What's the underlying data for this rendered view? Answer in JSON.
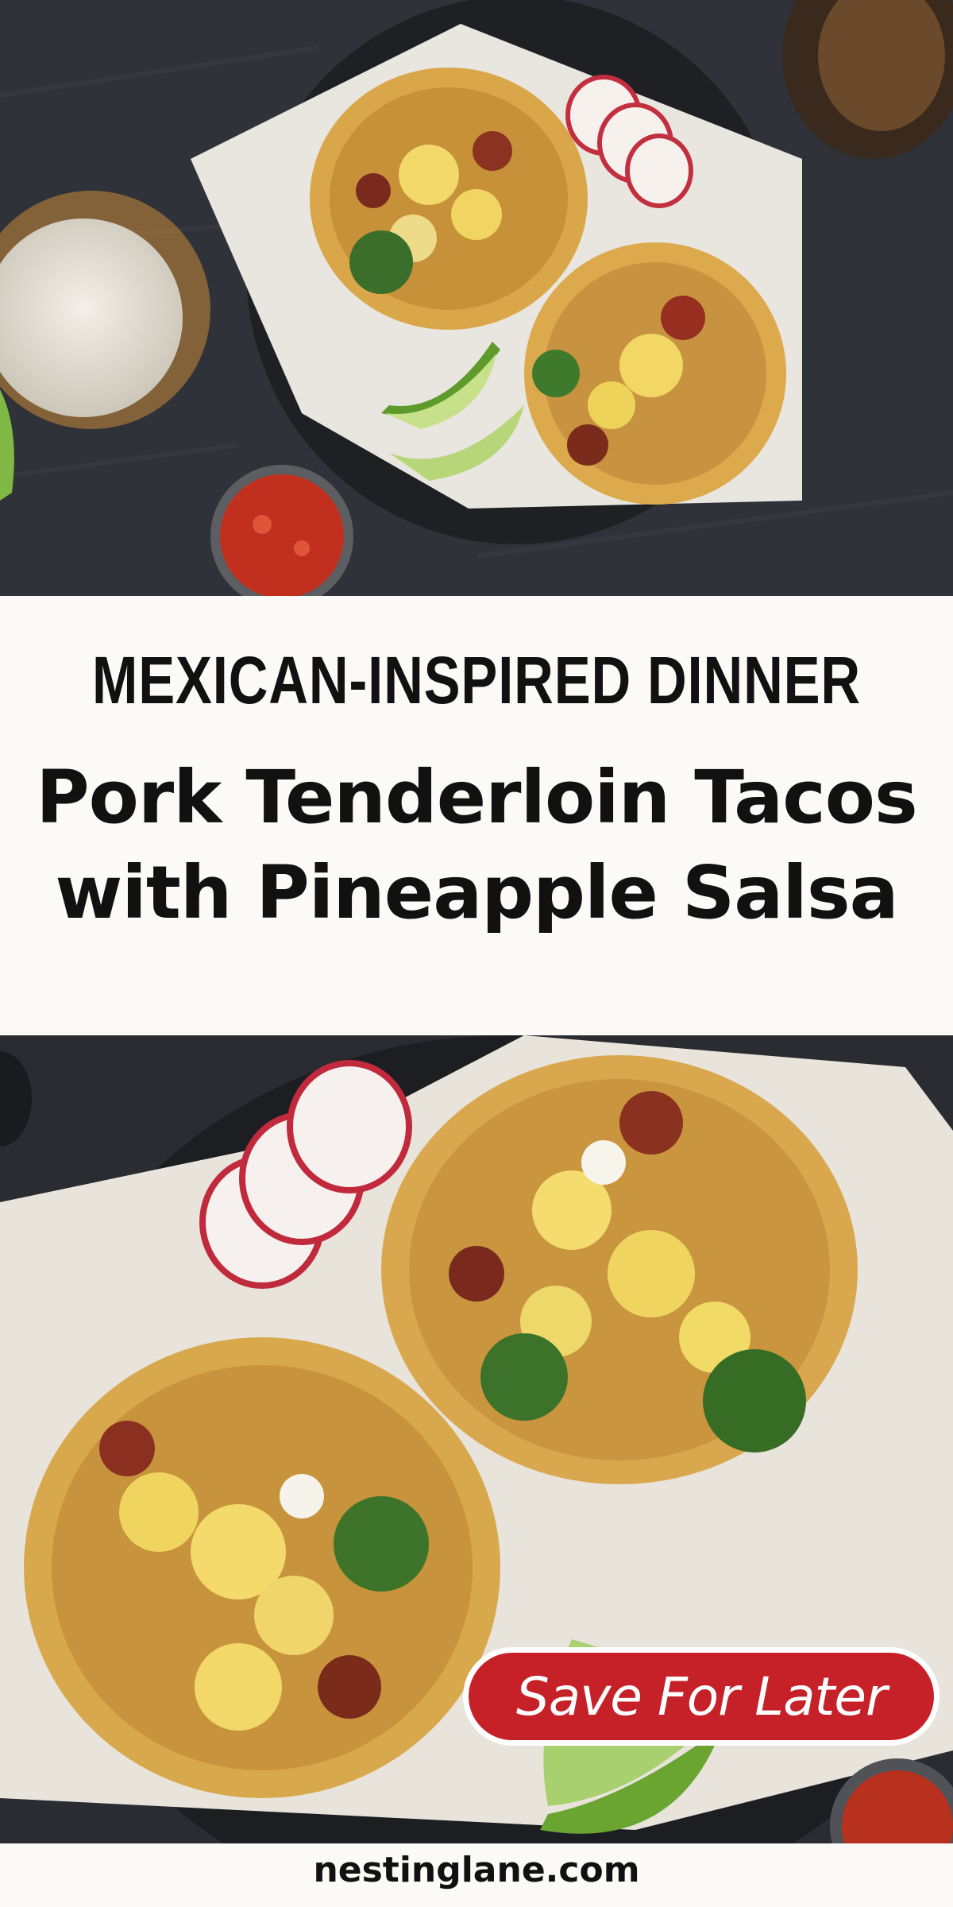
{
  "pin": {
    "kicker": "MEXICAN-INSPIRED DINNER",
    "title_line_1": "Pork Tenderloin Tacos",
    "title_line_2": "with Pineapple Salsa",
    "save_button_label": "Save For Later",
    "website": "nestinglane.com"
  },
  "colors": {
    "background": "#fbfaf7",
    "text": "#111111",
    "button_red": "#c62128",
    "slate": "#2c2f35"
  },
  "images": {
    "top_photo": "tacos-overhead-photo",
    "bottom_photo": "tacos-closeup-photo"
  }
}
